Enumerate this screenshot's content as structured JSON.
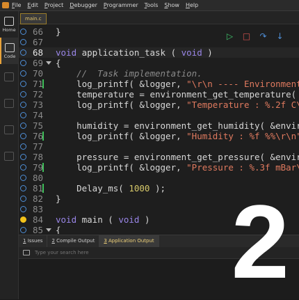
{
  "menu": [
    "File",
    "Edit",
    "Project",
    "Debugger",
    "Programmer",
    "Tools",
    "Show",
    "Help"
  ],
  "sidebar": [
    {
      "label": "Home"
    },
    {
      "label": "Code"
    },
    {
      "label": "Build"
    },
    {
      "label": "Run"
    },
    {
      "label": "Debug"
    },
    {
      "label": "Help"
    }
  ],
  "file_tab": "main.c",
  "code_lines": [
    {
      "n": "66",
      "tokens": [
        {
          "t": "}",
          "c": "plain"
        }
      ]
    },
    {
      "n": "67",
      "tokens": []
    },
    {
      "n": "68",
      "current": true,
      "tokens": [
        {
          "t": "void",
          "c": "kw"
        },
        {
          "t": " application_task ( ",
          "c": "plain"
        },
        {
          "t": "void",
          "c": "kw"
        },
        {
          "t": " )",
          "c": "plain"
        }
      ]
    },
    {
      "n": "69",
      "fold": true,
      "tokens": [
        {
          "t": "{",
          "c": "plain"
        }
      ]
    },
    {
      "n": "70",
      "tokens": [
        {
          "t": "    //  Task implementation.",
          "c": "cmt"
        }
      ]
    },
    {
      "n": "71",
      "marker": true,
      "tokens": [
        {
          "t": "    log_printf( &logger, ",
          "c": "plain"
        },
        {
          "t": "\"\\r\\n ---- Environment d",
          "c": "str"
        }
      ]
    },
    {
      "n": "72",
      "tokens": [
        {
          "t": "    temperature = environment_get_temperature( &e",
          "c": "plain"
        }
      ]
    },
    {
      "n": "73",
      "tokens": [
        {
          "t": "    log_printf( &logger, ",
          "c": "plain"
        },
        {
          "t": "\"Temperature : %.2f C\\r\\",
          "c": "str"
        }
      ]
    },
    {
      "n": "74",
      "tokens": []
    },
    {
      "n": "75",
      "tokens": [
        {
          "t": "    humidity = environment_get_humidity( &environ",
          "c": "plain"
        }
      ]
    },
    {
      "n": "76",
      "marker": true,
      "tokens": [
        {
          "t": "    log_printf( &logger, ",
          "c": "plain"
        },
        {
          "t": "\"Humidity : %f %%\\r\\n\"",
          "c": "str"
        },
        {
          "t": ", ",
          "c": "plain"
        }
      ]
    },
    {
      "n": "77",
      "tokens": []
    },
    {
      "n": "78",
      "tokens": [
        {
          "t": "    pressure = environment_get_pressure( &environ",
          "c": "plain"
        }
      ]
    },
    {
      "n": "79",
      "marker": true,
      "tokens": [
        {
          "t": "    log_printf( &logger, ",
          "c": "plain"
        },
        {
          "t": "\"Pressure : %.3f mBar\\r\\",
          "c": "str"
        }
      ]
    },
    {
      "n": "80",
      "tokens": []
    },
    {
      "n": "81",
      "marker": true,
      "tokens": [
        {
          "t": "    Delay_ms( ",
          "c": "plain"
        },
        {
          "t": "1000",
          "c": "num"
        },
        {
          "t": " );",
          "c": "plain"
        }
      ]
    },
    {
      "n": "82",
      "tokens": [
        {
          "t": "}",
          "c": "plain"
        }
      ]
    },
    {
      "n": "83",
      "tokens": []
    },
    {
      "n": "84",
      "breakpoint_hit": true,
      "tokens": [
        {
          "t": "void",
          "c": "kw"
        },
        {
          "t": " main ( ",
          "c": "plain"
        },
        {
          "t": "void",
          "c": "kw"
        },
        {
          "t": " )",
          "c": "plain"
        }
      ]
    },
    {
      "n": "85",
      "fold": true,
      "tokens": [
        {
          "t": "{",
          "c": "plain"
        }
      ]
    }
  ],
  "bottom_tabs": [
    {
      "num": "1",
      "label": " Issues"
    },
    {
      "num": "2",
      "label": " Compile Output"
    },
    {
      "num": "3",
      "label": " Application Output",
      "active": true
    }
  ],
  "search": {
    "placeholder": "Type your search here"
  },
  "overlay_number": "2",
  "colors": {
    "accent": "#e8a33b",
    "keyword": "#9a86e8",
    "string": "#e07a5f",
    "number": "#d7c96a"
  }
}
